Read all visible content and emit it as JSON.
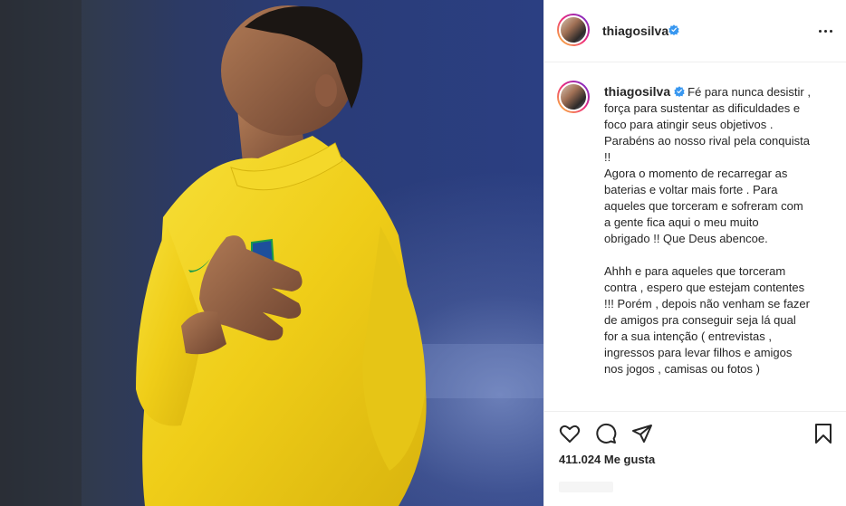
{
  "post": {
    "photo_alt": "photo",
    "author": {
      "username": "thiagosilva",
      "verified": true,
      "avatar_icon": "profile-avatar"
    },
    "caption_lines": [
      "Fé para nunca desistir ,",
      "força para sustentar as dificuldades e",
      "foco para atingir seus objetivos .",
      "Parabéns ao nosso rival pela conquista",
      "!!",
      "Agora o momento de recarregar as",
      "baterias e voltar mais forte . Para",
      "aqueles que torceram e sofreram com",
      "a gente fica aqui o meu muito",
      "obrigado !! Que Deus abencoe.",
      "",
      "Ahhh e para aqueles que torceram",
      "contra , espero que estejam contentes",
      "!!! Porém , depois não venham se fazer",
      "de amigos pra conseguir seja lá qual",
      "for a sua intenção ( entrevistas ,",
      "ingressos para levar filhos e amigos",
      "nos jogos , camisas ou fotos )"
    ],
    "likes_text": "411.024 Me gusta",
    "icons": {
      "more": "more-options-icon",
      "like": "heart-icon",
      "comment": "comment-icon",
      "share": "paper-plane-icon",
      "save": "bookmark-icon",
      "verified": "verified-badge-icon"
    },
    "colors": {
      "verified_blue": "#3897f0",
      "text": "#262626",
      "border": "#efefef",
      "jersey_yellow": "#f2d21a",
      "jersey_green": "#1a9a4a"
    }
  }
}
